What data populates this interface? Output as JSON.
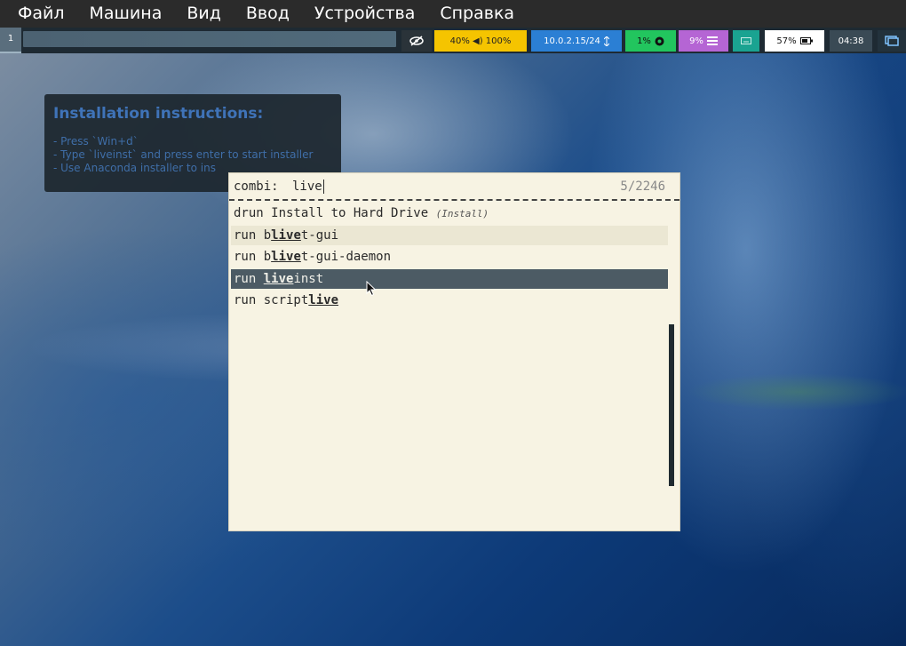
{
  "vbox_menubar": {
    "items": [
      "Файл",
      "Машина",
      "Вид",
      "Ввод",
      "Устройства",
      "Справка"
    ]
  },
  "status_bar": {
    "workspace": "1",
    "volume": "40% ◀) 100%",
    "network": "10.0.2.15/24",
    "cpu": "1%",
    "memory": "9%",
    "battery": "57%",
    "clock": "04:38",
    "icons": {
      "privacy": "eye-slash-icon",
      "volume": "speaker-icon",
      "network": "network-icon",
      "cpu": "cpu-icon",
      "memory": "memory-icon",
      "keyboard": "keyboard-icon",
      "battery": "battery-icon",
      "tray": "display-tray-icon"
    },
    "colors": {
      "volume": "#f5c400",
      "network": "#2b7fd4",
      "cpu": "#22c55e",
      "memory": "#b565d4",
      "keyboard": "#1aa391"
    }
  },
  "instructions": {
    "title": "Installation instructions:",
    "lines": [
      "- Press `Win+d`",
      "- Type `liveinst` and press enter to start installer",
      "- Use Anaconda installer to ins"
    ]
  },
  "launcher": {
    "prompt": "combi:",
    "query": "live",
    "counter": "5/2246",
    "results": [
      {
        "prefix": "drun Install to Hard Drive ",
        "match": "",
        "suffix": "",
        "tag": "(Install)",
        "state": "normal"
      },
      {
        "prefix": "run b",
        "match": "live",
        "suffix": "t-gui",
        "tag": "",
        "state": "alt"
      },
      {
        "prefix": "run b",
        "match": "live",
        "suffix": "t-gui-daemon",
        "tag": "",
        "state": "normal"
      },
      {
        "prefix": "run ",
        "match": "live",
        "suffix": "inst",
        "tag": "",
        "state": "selected"
      },
      {
        "prefix": "run script",
        "match": "live",
        "suffix": "",
        "tag": "",
        "state": "normal"
      }
    ]
  }
}
